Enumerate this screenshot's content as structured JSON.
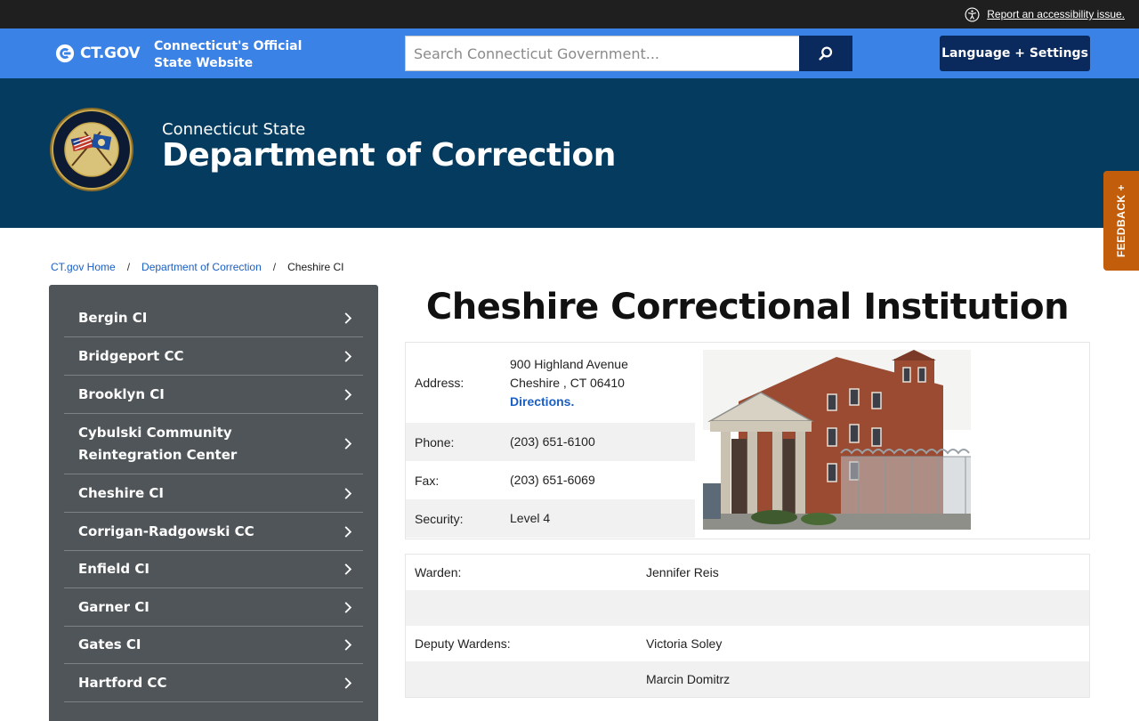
{
  "accessibility": {
    "link_text": "Report an accessibility issue."
  },
  "ctgov": {
    "logo_text": "CT.GOV",
    "tagline": "Connecticut's Official State Website",
    "search_placeholder": "Search Connecticut Government...",
    "language_button": "Language + Settings"
  },
  "agency": {
    "subtitle": "Connecticut State",
    "title": "Department of Correction"
  },
  "feedback": {
    "label": "FEEDBACK +"
  },
  "breadcrumb": {
    "home": "CT.gov Home",
    "dept": "Department of Correction",
    "current": "Cheshire CI",
    "separator": "/"
  },
  "sidebar": {
    "items": [
      {
        "label": "Bergin CI"
      },
      {
        "label": "Bridgeport CC"
      },
      {
        "label": "Brooklyn CI"
      },
      {
        "label": "Cybulski Community Reintegration Center"
      },
      {
        "label": "Cheshire CI"
      },
      {
        "label": "Corrigan-Radgowski CC"
      },
      {
        "label": "Enfield CI"
      },
      {
        "label": "Garner CI"
      },
      {
        "label": "Gates CI"
      },
      {
        "label": "Hartford CC"
      }
    ]
  },
  "facility": {
    "title": "Cheshire Correctional Institution",
    "address_label": "Address:",
    "address_line1": "900 Highland Avenue",
    "address_line2": "Cheshire , CT 06410",
    "directions": "Directions.",
    "phone_label": "Phone:",
    "phone": "(203) 651-6100",
    "fax_label": "Fax:",
    "fax": "(203) 651-6069",
    "security_label": "Security:",
    "security": "Level 4"
  },
  "staff": {
    "warden_label": "Warden:",
    "warden": "Jennifer Reis",
    "deputy_label": "Deputy Wardens:",
    "deputy_1": "Victoria Soley",
    "deputy_2": "Marcin Domitrz"
  },
  "colors": {
    "ctgov_blue": "#3b82e6",
    "navy": "#0a2a5e",
    "banner": "#053b5e",
    "sidebar": "#4f5558",
    "feedback": "#c25e0b",
    "link": "#1a5fc4"
  }
}
